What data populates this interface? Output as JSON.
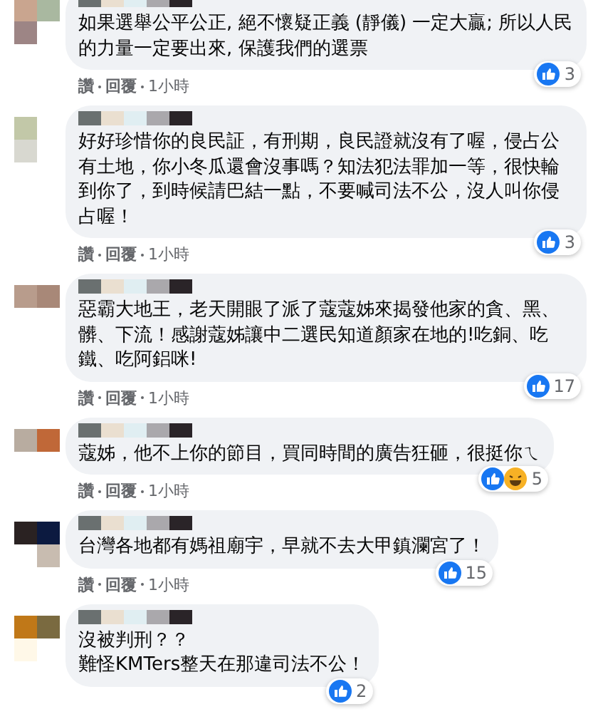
{
  "comments": [
    {
      "text": "如果選舉公平公正, 絕不懷疑正義 (靜儀) 一定大贏; 所以人民的力量一定要出來, 保護我們的選票",
      "actions": [
        "讚",
        "回覆",
        "1小時"
      ],
      "reactions": [
        {
          "kind": "like"
        }
      ],
      "count": "3"
    },
    {
      "text": "好好珍惜你的良民証，有刑期，良民證就沒有了喔，侵占公有土地，你小冬瓜還會沒事嗎？知法犯法罪加一等，很快輪到你了，到時候請巴結一點，不要喊司法不公，沒人叫你侵占喔！",
      "actions": [
        "讚",
        "回覆",
        "1小時"
      ],
      "reactions": [
        {
          "kind": "like"
        }
      ],
      "count": "3"
    },
    {
      "text": "惡霸大地王，老天開眼了派了蔻蔻姊來揭發他家的貪、黑、髒、下流！感謝蔻姊讓中二選民知道顏家在地的!吃銅、吃鐵、吃阿鋁咪!",
      "actions": [
        "讚",
        "回覆",
        "1小時"
      ],
      "reactions": [
        {
          "kind": "like"
        }
      ],
      "count": "17"
    },
    {
      "text": "蔻姊，他不上你的節目，買同時間的廣告狂砸，很挺你ㄟ",
      "actions": [
        "讚",
        "回覆",
        "1小時"
      ],
      "reactions": [
        {
          "kind": "like"
        },
        {
          "kind": "haha"
        }
      ],
      "count": "5"
    },
    {
      "text": "台灣各地都有媽祖廟宇，早就不去大甲鎮瀾宮了！",
      "actions": [
        "讚",
        "回覆",
        "1小時"
      ],
      "reactions": [
        {
          "kind": "like"
        }
      ],
      "count": "15"
    },
    {
      "lines": [
        "沒被判刑？？",
        "難怪KMTers整天在那違司法不公！"
      ],
      "reactions": [
        {
          "kind": "like"
        }
      ],
      "count": "2"
    }
  ]
}
